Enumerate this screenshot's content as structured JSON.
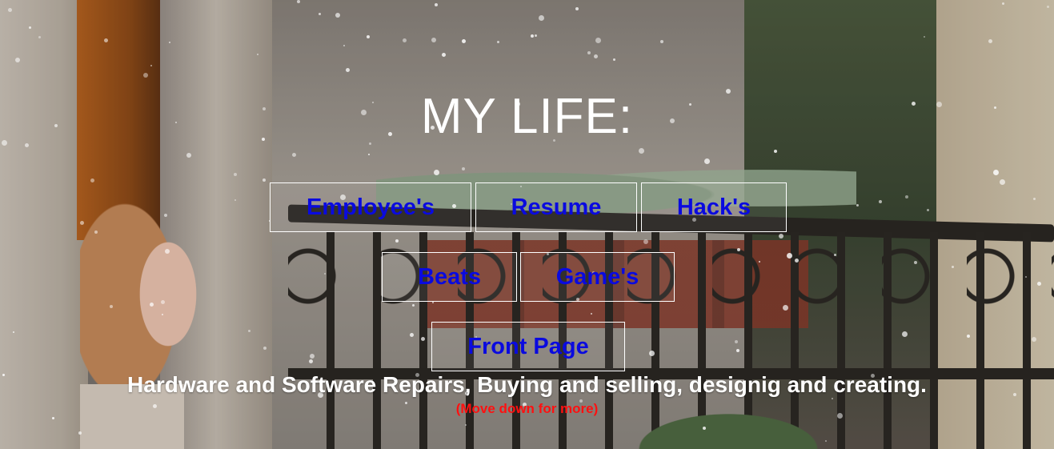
{
  "header": {
    "title": "MY LIFE:"
  },
  "nav": {
    "buttons": [
      {
        "label": "Employee's"
      },
      {
        "label": "Resume"
      },
      {
        "label": "Hack's"
      },
      {
        "label": "Beats"
      },
      {
        "label": "Game's"
      },
      {
        "label": "Front Page"
      }
    ]
  },
  "tagline": "Hardware and Software Repairs, Buying and selling, designig and creating.",
  "scroll_hint": "(Move down for more)",
  "colors": {
    "title": "#ffffff",
    "button_text": "#0a0adf",
    "button_border": "#ffffff",
    "tagline": "#ffffff",
    "scroll_hint": "#ff1010"
  }
}
